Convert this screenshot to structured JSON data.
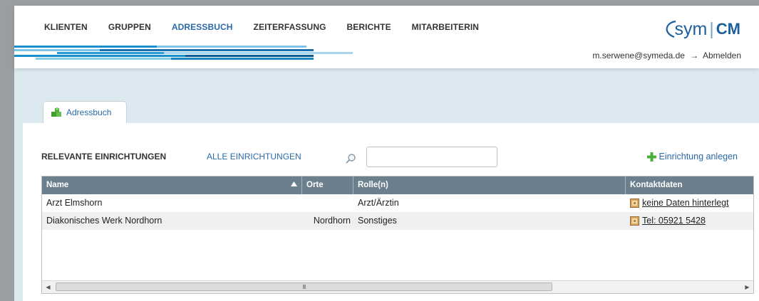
{
  "nav": {
    "items": [
      "KLIENTEN",
      "GRUPPEN",
      "ADRESSBUCH",
      "ZEITERFASSUNG",
      "BERICHTE",
      "MITARBEITERIN"
    ],
    "active": "ADRESSBUCH"
  },
  "logo": {
    "sym": "sym",
    "cm": "CM"
  },
  "user": {
    "email": "m.serwene@symeda.de",
    "arrow": "→",
    "logout": "Abmelden"
  },
  "tab": {
    "label": "Adressbuch"
  },
  "subnav": {
    "relevant": "RELEVANTE EINRICHTUNGEN",
    "all": "ALLE EINRICHTUNGEN"
  },
  "search": {
    "value": "",
    "placeholder": ""
  },
  "actions": {
    "add": "Einrichtung anlegen"
  },
  "table": {
    "headers": [
      "Name",
      "Orte",
      "Rolle(n)",
      "Kontaktdaten"
    ],
    "rows": [
      {
        "name": "Arzt Elmshorn",
        "orte": "",
        "rolle": "Arzt/Ärztin",
        "kontakt": "keine Daten hinterlegt"
      },
      {
        "name": "Diakonisches Werk Nordhorn",
        "orte": "Nordhorn",
        "rolle": "Sonstiges",
        "kontakt": "Tel: 05921 5428"
      }
    ],
    "scroll_thumb_label": "III"
  },
  "colors": {
    "accent": "#2a6aa6",
    "header_row": "#6b7f8c",
    "background": "#dce9f0",
    "add_icon": "#4caf3a"
  }
}
